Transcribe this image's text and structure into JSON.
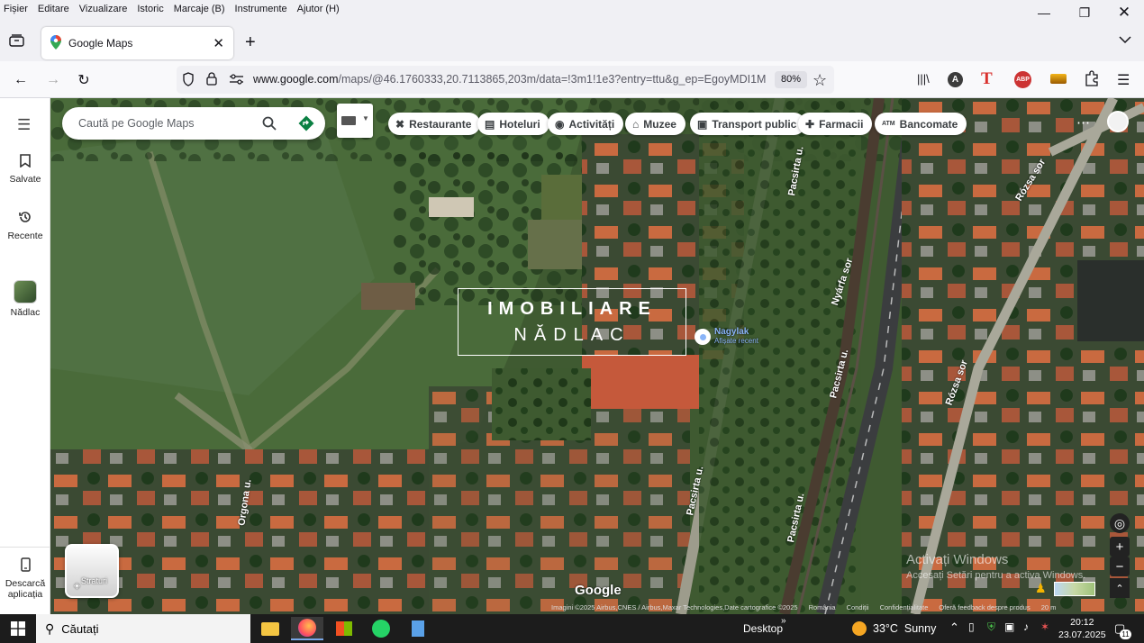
{
  "menubar": [
    "Fișier",
    "Editare",
    "Vizualizare",
    "Istoric",
    "Marcaje (B)",
    "Instrumente",
    "Ajutor (H)"
  ],
  "tab": {
    "title": "Google Maps"
  },
  "url": {
    "host": "www.google.com",
    "path": "/maps/@46.1760333,20.7113865,203m/data=!3m1!1e3?entry=ttu&g_ep=EgoyMDI1MDcyMC4w",
    "zoom": "80%"
  },
  "sidebar": {
    "saved": "Salvate",
    "recent": "Recente",
    "place": "Nădlac",
    "download": "Descarcă aplicația"
  },
  "search": {
    "placeholder": "Caută pe Google Maps"
  },
  "chips": [
    "Restaurante",
    "Hoteluri",
    "Activități",
    "Muzee",
    "Transport public",
    "Farmacii",
    "Bancomate"
  ],
  "chip_icons": [
    "fork-knife-icon",
    "bed-icon",
    "camera-icon",
    "museum-icon",
    "bus-icon",
    "pharmacy-icon",
    "atm-icon"
  ],
  "watermark": {
    "line1": "IMOBILIARE",
    "line2": "NĂDLAC"
  },
  "pin": {
    "name": "Nagylak",
    "sub": "Afișate recent"
  },
  "streets": [
    "Nyárfa sor",
    "Pacsirta u.",
    "Pacsirta u.",
    "Pacsirta u.",
    "Rózsa sor",
    "Rózsa sor",
    "Orgona u.",
    "Pacsirta u."
  ],
  "layers_label": "Straturi",
  "google_logo": "Google",
  "attribution": [
    "Imagini ©2025 Airbus,CNES / Airbus,Maxar Technologies,Date cartografice ©2025",
    "România",
    "Condiții",
    "Confidențialitate",
    "Oferă feedback despre produs",
    "20 m"
  ],
  "activate": {
    "title": "Activați Windows",
    "sub": "Accesați Setări pentru a activa Windows."
  },
  "taskbar": {
    "search": "Căutați",
    "desktop": "Desktop",
    "weather": "33°C  Sunny",
    "time": "20:12",
    "date": "23.07.2025",
    "notif": "11"
  },
  "colors": {
    "accent": "#1a73e8",
    "directions": "#0b8043",
    "abp": "#c33",
    "taskbar": "#1c1c1c"
  }
}
